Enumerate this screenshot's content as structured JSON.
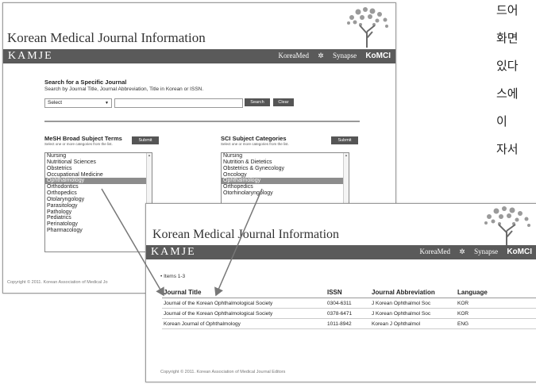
{
  "shot1": {
    "site_title": "Korean Medical Journal Information",
    "brand": "KAMJE",
    "nav": [
      "KoreaMed",
      "Synapse",
      "KoMCI"
    ],
    "search": {
      "title": "Search for a Specific Journal",
      "subtitle": "Search by Journal Title, Journal Abbreviation, Title in Korean or ISSN.",
      "select_value": "Select",
      "search_button": "Search",
      "clear_button": "Clear"
    },
    "mesh": {
      "title": "MeSH Broad Subject Terms",
      "hint": "Select one or more categories from the list.",
      "submit": "Submit",
      "items": [
        "Nursing",
        "Nutritional Sciences",
        "Obstetrics",
        "Occupational Medicine",
        "Ophthalmology",
        "Orthodontics",
        "Orthopedics",
        "Otolaryngology",
        "Parasitology",
        "Pathology",
        "Pediatrics",
        "Perinatology",
        "Pharmacology"
      ],
      "selected": "Ophthalmology"
    },
    "sci": {
      "title": "SCI Subject Categories",
      "hint": "Select one or more categories from the list.",
      "submit": "Submit",
      "items": [
        "Nursing",
        "Nutrition & Dietetics",
        "Obstetrics & Gynecology",
        "Oncology",
        "Ophthalmology",
        "Orthopedics",
        "Otorhinolaryngology"
      ],
      "selected": "Ophthalmology"
    },
    "footer": "Copyright © 2011. Korean Association of Medical Jo"
  },
  "shot2": {
    "site_title": "Korean Medical Journal Information",
    "brand": "KAMJE",
    "nav": [
      "KoreaMed",
      "Synapse",
      "KoMCI"
    ],
    "items_count": "• Items 1-3",
    "table": {
      "headers": [
        "Journal Title",
        "ISSN",
        "Journal Abbreviation",
        "Language"
      ],
      "rows": [
        [
          "Journal of the Korean Ophthalmological Society",
          "0304-6311",
          "J Korean Ophthalmol Soc",
          "KOR"
        ],
        [
          "Journal of the Korean Ophthalmological Society",
          "0378-6471",
          "J Korean Ophthalmol Soc",
          "KOR"
        ],
        [
          "Korean Journal of Ophthalmology",
          "1011-8942",
          "Korean J Ophthalmol",
          "ENG"
        ]
      ]
    },
    "footer": "Copyright © 2011. Korean Association of Medical Journal Editors"
  },
  "side_text": [
    "드어",
    "화면",
    "있다",
    "스에",
    "이",
    "자서"
  ]
}
